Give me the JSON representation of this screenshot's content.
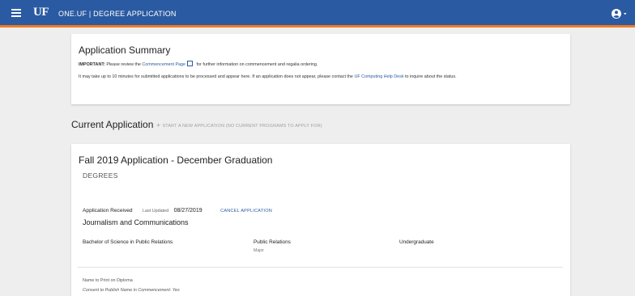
{
  "header": {
    "logo": "UF",
    "app_title": "ONE.UF | DEGREE APPLICATION"
  },
  "summary": {
    "title": "Application Summary",
    "important_label": "IMPORTANT:",
    "important_text_pre": "Please review the",
    "commencement_link": "Commencement Page",
    "important_text_post": "for further information on commencement and regalia ordering.",
    "note_pre": "It may take up to 10 minutes for submitted applications to be processed and appear here. If an application does not appear, please contact the",
    "help_desk_link": "UF Computing Help Desk",
    "note_post": "to inquire about the status."
  },
  "current": {
    "heading": "Current Application",
    "start_new": "START A NEW APPLICATION (NO CURRENT PROGRAMS TO APPLY FOR)"
  },
  "application": {
    "title": "Fall 2019 Application - December Graduation",
    "section": "DEGREES",
    "status": "Application Received",
    "last_updated_label": "Last Updated",
    "last_updated": "08/27/2019",
    "cancel_label": "CANCEL APPLICATION",
    "college": "Journalism and Communications",
    "degree": "Bachelor of Science in Public Relations",
    "major": "Public Relations",
    "major_label": "Major",
    "level": "Undergraduate",
    "diploma_label": "Name to Print on Diploma",
    "consent": "Consent to Publish Name in Commencement: Yes"
  },
  "colors": {
    "header_bg": "#2a5aa1",
    "header_accent": "#f07a1f",
    "link": "#2a5aa1"
  }
}
